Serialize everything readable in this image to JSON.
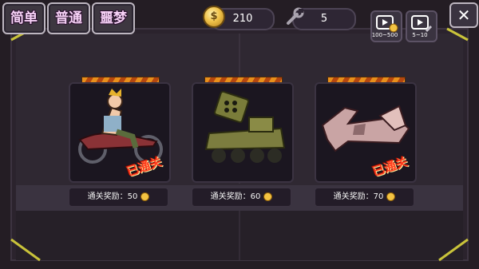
{
  "tabs": [
    {
      "label": "简单"
    },
    {
      "label": "普通"
    },
    {
      "label": "噩梦"
    }
  ],
  "resources": {
    "coins": "210",
    "tools": "5"
  },
  "top_buttons": [
    {
      "label": "100~500",
      "icon": "video-coin-icon"
    },
    {
      "label": "5~10",
      "icon": "video-tool-icon"
    }
  ],
  "close_label": "✕",
  "cards": [
    {
      "vehicle": "motorcycle",
      "reward": "通关奖励：50",
      "cleared": true,
      "stamp": "已通关"
    },
    {
      "vehicle": "rocket-tank",
      "reward": "通关奖励：60",
      "cleared": false,
      "stamp": ""
    },
    {
      "vehicle": "jet-plane",
      "reward": "通关奖励：70",
      "cleared": true,
      "stamp": "已通关"
    }
  ],
  "colors": {
    "panel_bg": "#2a222e",
    "accent_orange": "#e8901c",
    "stamp_red": "#ff3a1e",
    "tab_text": "#f6d1f6"
  }
}
